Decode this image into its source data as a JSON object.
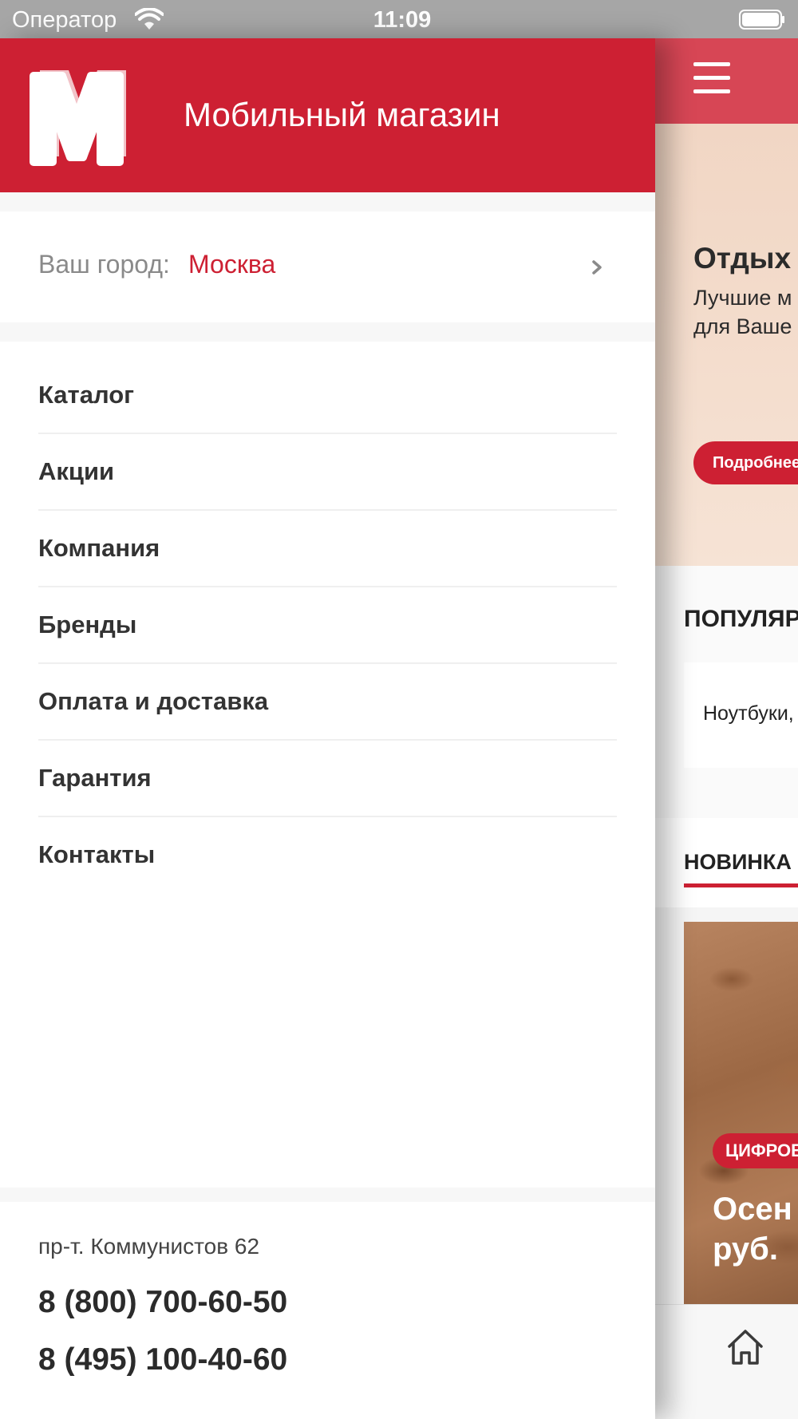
{
  "status_bar": {
    "carrier": "Оператор",
    "time": "11:09"
  },
  "drawer": {
    "shop_name": "Мобильный магазин",
    "city": {
      "label": "Ваш город:",
      "value": "Москва"
    },
    "menu": [
      {
        "label": "Каталог"
      },
      {
        "label": "Акции"
      },
      {
        "label": "Компания"
      },
      {
        "label": "Бренды"
      },
      {
        "label": "Оплата и доставка"
      },
      {
        "label": "Гарантия"
      },
      {
        "label": "Контакты"
      }
    ],
    "footer": {
      "address": "пр-т. Коммунистов 62",
      "phones": [
        "8 (800) 700-60-50",
        "8 (495) 100-40-60"
      ]
    }
  },
  "background_app": {
    "banner": {
      "title": "Отдых",
      "subtitle_line1": "Лучшие м",
      "subtitle_line2": "для Ваше",
      "button": "Подробнее"
    },
    "popular": {
      "title": "ПОПУЛЯР",
      "item": "Ноутбуки,"
    },
    "new_tab": "НОВИНКА",
    "product": {
      "badge": "ЦИФРОВ",
      "title_line1": "Осен",
      "title_line2": "руб."
    }
  },
  "colors": {
    "brand": "#cd2033",
    "header_right": "#d74655"
  }
}
